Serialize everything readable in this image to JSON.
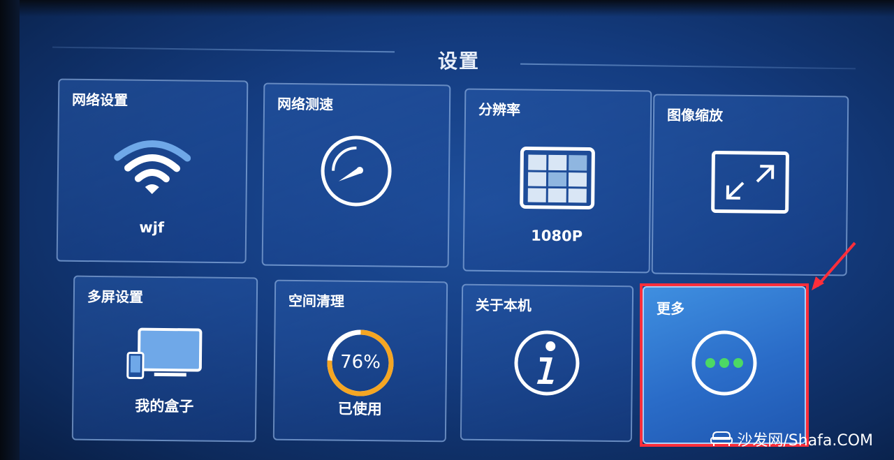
{
  "header": {
    "title": "设置"
  },
  "tiles": [
    {
      "label": "网络设置",
      "sub": "wjf",
      "icon": "wifi-icon"
    },
    {
      "label": "网络测速",
      "sub": "",
      "icon": "speedometer-icon"
    },
    {
      "label": "分辨率",
      "sub": "1080P",
      "icon": "resolution-grid-icon"
    },
    {
      "label": "图像缩放",
      "sub": "",
      "icon": "expand-arrows-icon"
    },
    {
      "label": "多屏设置",
      "sub": "我的盒子",
      "icon": "multi-screen-icon"
    },
    {
      "label": "空间清理",
      "sub": "已使用",
      "icon": "storage-ring-icon",
      "usage_percent": "76%",
      "usage_value": 76
    },
    {
      "label": "关于本机",
      "sub": "",
      "icon": "info-icon"
    },
    {
      "label": "更多",
      "sub": "",
      "icon": "more-dots-icon"
    }
  ],
  "selected_tile": "更多",
  "watermark": {
    "text": "沙发网/Shafa.COM"
  },
  "colors": {
    "background": "#143c80",
    "selected_tile": "#2a6cc8",
    "highlight_border": "#ff2e3a",
    "storage_ring": "#f5a623",
    "more_dots": "#4cd964"
  }
}
